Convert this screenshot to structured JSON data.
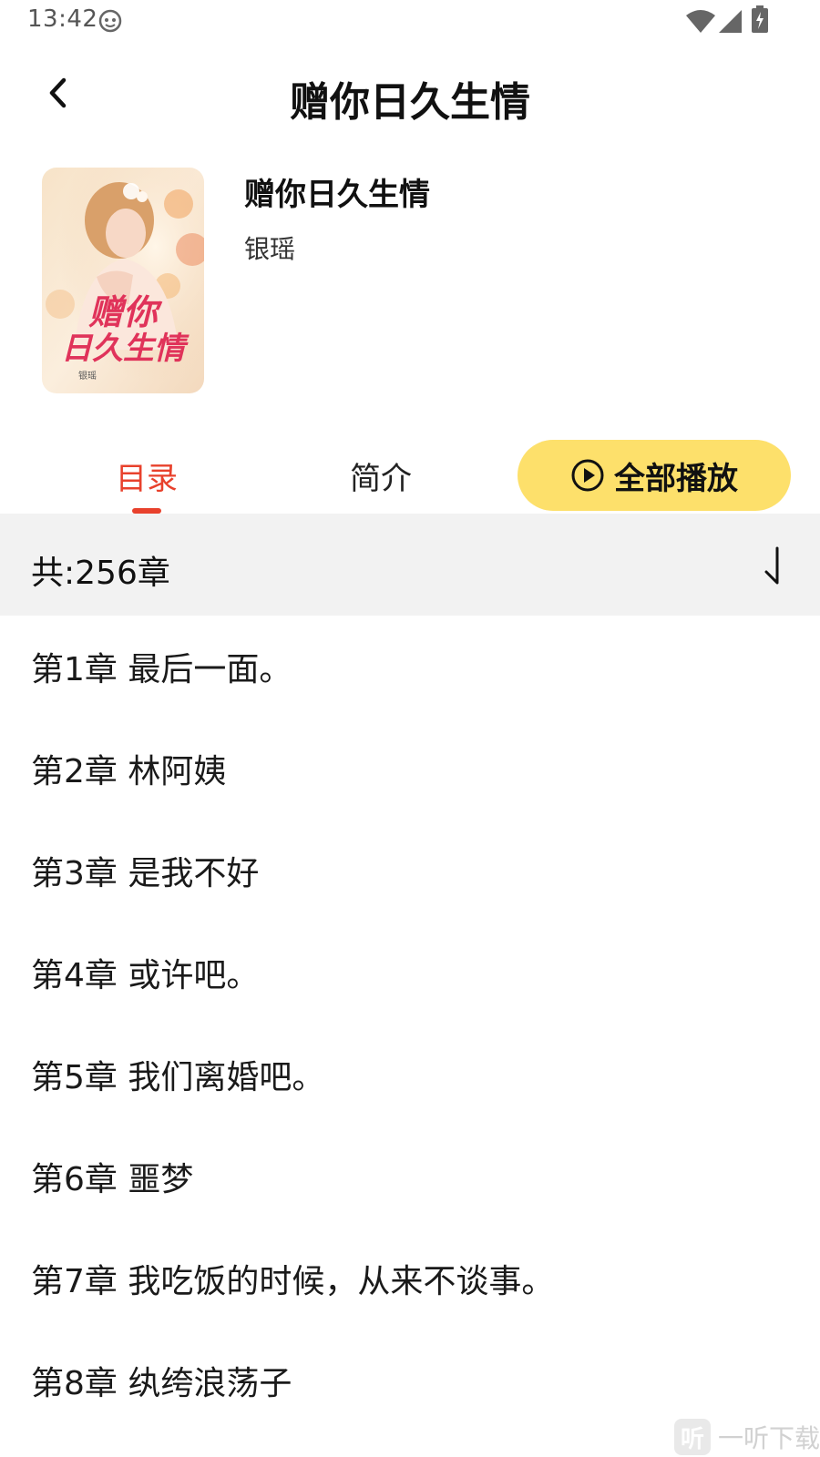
{
  "status_bar": {
    "time": "13:42",
    "icons": [
      "app-notification-icon",
      "wifi-icon",
      "signal-icon",
      "battery-charging-icon"
    ]
  },
  "header": {
    "back_icon": "chevron-left-icon",
    "title": "赠你日久生情"
  },
  "book": {
    "cover_title_line1": "赠你",
    "cover_title_line2": "日久生情",
    "cover_author": "银瑶",
    "title": "赠你日久生情",
    "author": "银瑶"
  },
  "tabs": [
    {
      "label": "目录",
      "active": true
    },
    {
      "label": "简介",
      "active": false
    }
  ],
  "play_all": {
    "label": "全部播放",
    "icon": "play-circle-icon"
  },
  "chapter_count_label": "共:256章",
  "sort_icon": "sort-arrow-icon",
  "chapters": [
    "第1章 最后一面。",
    "第2章 林阿姨",
    "第3章 是我不好",
    "第4章 或许吧。",
    "第5章 我们离婚吧。",
    "第6章 噩梦",
    "第7章 我吃饭的时候，从来不谈事。",
    "第8章 纨绔浪荡子"
  ],
  "watermark": {
    "logo_char": "听",
    "text": "一听下载"
  },
  "colors": {
    "accent_red": "#e8412c",
    "play_button_yellow": "#fde06b",
    "count_bar_bg": "#f2f2f2"
  }
}
